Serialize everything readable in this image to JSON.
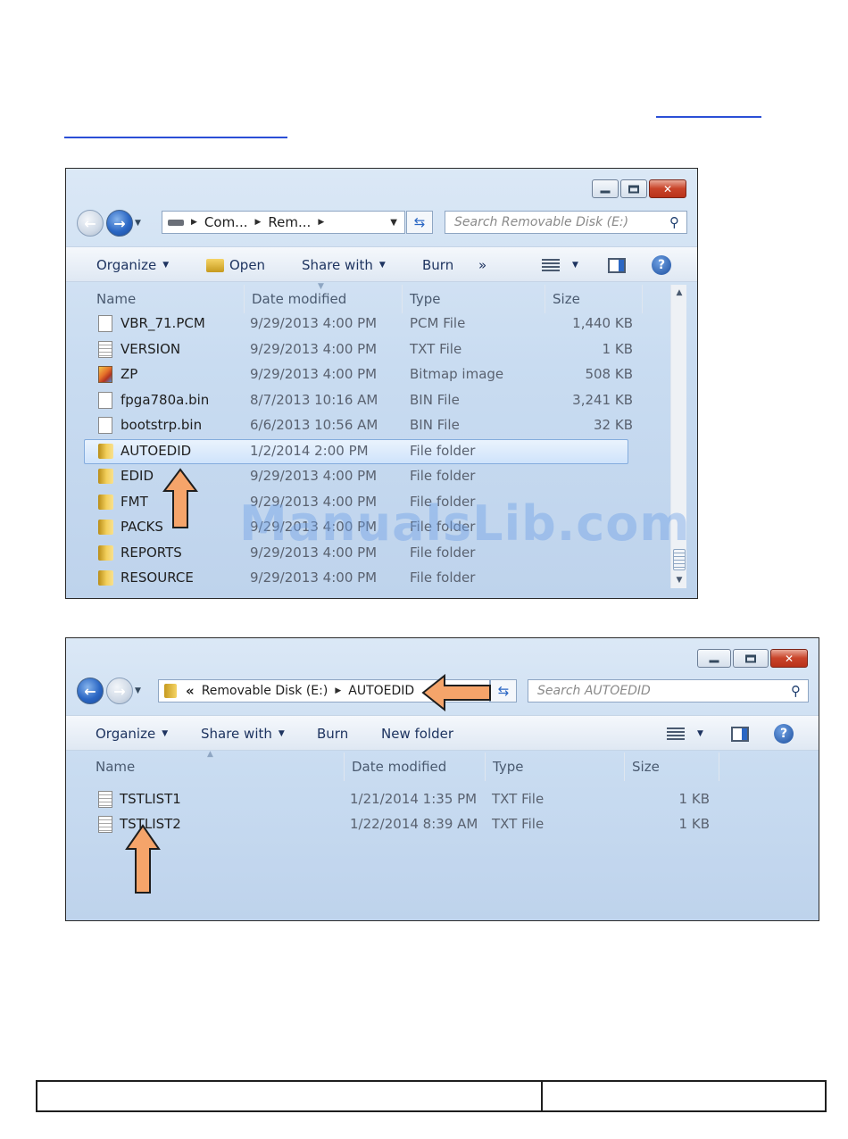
{
  "window1": {
    "address": {
      "segments": [
        "Com...",
        "Rem..."
      ]
    },
    "search_placeholder": "Search Removable Disk (E:)",
    "toolbar": {
      "organize": "Organize",
      "open": "Open",
      "share_with": "Share with",
      "burn": "Burn",
      "more": "»"
    },
    "columns": {
      "name": "Name",
      "date": "Date modified",
      "type": "Type",
      "size": "Size"
    },
    "files": [
      {
        "name": "VBR_71.PCM",
        "date": "9/29/2013 4:00 PM",
        "type": "PCM File",
        "size": "1,440 KB",
        "icon": "doc"
      },
      {
        "name": "VERSION",
        "date": "9/29/2013 4:00 PM",
        "type": "TXT File",
        "size": "1 KB",
        "icon": "txt"
      },
      {
        "name": "ZP",
        "date": "9/29/2013 4:00 PM",
        "type": "Bitmap image",
        "size": "508 KB",
        "icon": "bmp"
      },
      {
        "name": "fpga780a.bin",
        "date": "8/7/2013 10:16 AM",
        "type": "BIN File",
        "size": "3,241 KB",
        "icon": "doc"
      },
      {
        "name": "bootstrp.bin",
        "date": "6/6/2013 10:56 AM",
        "type": "BIN File",
        "size": "32 KB",
        "icon": "doc"
      },
      {
        "name": "AUTOEDID",
        "date": "1/2/2014 2:00 PM",
        "type": "File folder",
        "size": "",
        "icon": "folder",
        "selected": true
      },
      {
        "name": "EDID",
        "date": "9/29/2013 4:00 PM",
        "type": "File folder",
        "size": "",
        "icon": "folder"
      },
      {
        "name": "FMT",
        "date": "9/29/2013 4:00 PM",
        "type": "File folder",
        "size": "",
        "icon": "folder"
      },
      {
        "name": "PACKS",
        "date": "9/29/2013 4:00 PM",
        "type": "File folder",
        "size": "",
        "icon": "folder"
      },
      {
        "name": "REPORTS",
        "date": "9/29/2013 4:00 PM",
        "type": "File folder",
        "size": "",
        "icon": "folder"
      },
      {
        "name": "RESOURCE",
        "date": "9/29/2013 4:00 PM",
        "type": "File folder",
        "size": "",
        "icon": "folder"
      }
    ]
  },
  "window2": {
    "address": {
      "overflow": "«",
      "segments": [
        "Removable Disk (E:)",
        "AUTOEDID"
      ]
    },
    "search_placeholder": "Search AUTOEDID",
    "toolbar": {
      "organize": "Organize",
      "share_with": "Share with",
      "burn": "Burn",
      "new_folder": "New folder"
    },
    "columns": {
      "name": "Name",
      "date": "Date modified",
      "type": "Type",
      "size": "Size"
    },
    "files": [
      {
        "name": "TSTLIST1",
        "date": "1/21/2014 1:35 PM",
        "type": "TXT File",
        "size": "1 KB",
        "icon": "txt"
      },
      {
        "name": "TSTLIST2",
        "date": "1/22/2014 8:39 AM",
        "type": "TXT File",
        "size": "1 KB",
        "icon": "txt"
      }
    ]
  },
  "watermark": "ManualsLib.com",
  "colors": {
    "arrow_fill": "#f5a46a",
    "arrow_stroke": "#1e1e1e",
    "selection": "#cfe3fb",
    "link": "#2b4fd6"
  }
}
